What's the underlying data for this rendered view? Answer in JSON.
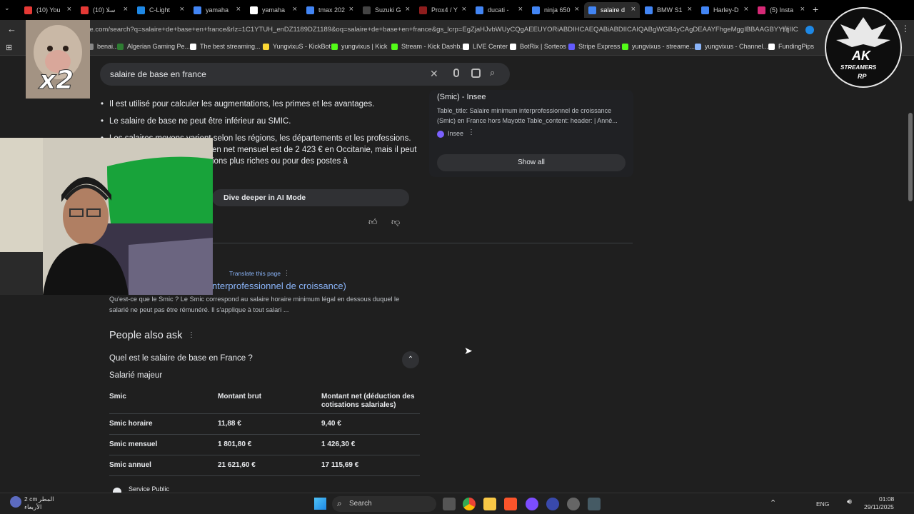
{
  "tabs": [
    {
      "label": "(10) You",
      "color": "#e53935",
      "active": false
    },
    {
      "label": "سلا (10)",
      "color": "#e53935",
      "active": false
    },
    {
      "label": "C-Light",
      "color": "#1e88e5",
      "active": false
    },
    {
      "label": "yamaha",
      "color": "#4285f4",
      "active": false
    },
    {
      "label": "yamaha",
      "color": "#ffffff",
      "active": false
    },
    {
      "label": "tmax 202",
      "color": "#4285f4",
      "active": false
    },
    {
      "label": "Suzuki G",
      "color": "#444444",
      "active": false
    },
    {
      "label": "Prox4 / Y",
      "color": "#8e1d1d",
      "active": false
    },
    {
      "label": "ducati -",
      "color": "#4285f4",
      "active": false
    },
    {
      "label": "ninja 650",
      "color": "#4285f4",
      "active": false
    },
    {
      "label": "salaire d",
      "color": "#4285f4",
      "active": true
    },
    {
      "label": "BMW S1",
      "color": "#4285f4",
      "active": false
    },
    {
      "label": "Harley-D",
      "color": "#4285f4",
      "active": false
    },
    {
      "label": "(5) Insta",
      "color": "#d62976",
      "active": false
    }
  ],
  "address": {
    "url": "gle.com/search?q=salaire+de+base+en+france&rlz=1C1YTUH_enDZ1189DZ1189&oq=salaire+de+base+en+france&gs_lcrp=EgZjaHJvbWUyCQgAEEUYORiABDIHCAEQABiABDIICAIQABgWGB4yCAgDEAAYFhgeMggIBBAAGBYYHjIICA..."
  },
  "bookmarks": [
    {
      "label": "benai...",
      "color": "#888888"
    },
    {
      "label": "Algerian Gaming Pe...",
      "color": "#2e7d32"
    },
    {
      "label": "The best streaming...",
      "color": "#ffffff"
    },
    {
      "label": "YungvixuS - KickBot",
      "color": "#fdd835"
    },
    {
      "label": "yungvixus | Kick",
      "color": "#53fc18"
    },
    {
      "label": "Stream - Kick Dashb...",
      "color": "#53fc18"
    },
    {
      "label": "LIVE Center",
      "color": "#ffffff"
    },
    {
      "label": "BotRix | Sorteos",
      "color": "#ffffff"
    },
    {
      "label": "Stripe Express",
      "color": "#635bff"
    },
    {
      "label": "yungvixus - streame...",
      "color": "#53fc18"
    },
    {
      "label": "yungvixus - Channel...",
      "color": "#8ab4f8"
    },
    {
      "label": "FundingPips",
      "color": "#ffffff"
    }
  ],
  "search": {
    "query": "salaire de base en france"
  },
  "ai_overview": {
    "bullet1": "Il est utilisé pour calculer les augmentations, les primes et les avantages.",
    "bullet2": "Le salaire de base ne peut être inférieur au SMIC.",
    "bullet3": "Les salaires moyens varient selon les régions, les départements et les professions.",
    "line3b": "en net mensuel est de 2 423 € en Occitanie, mais il peut",
    "line3c": "ions plus riches ou pour des postes à",
    "dive_label": "Dive deeper in AI Mode"
  },
  "right_card": {
    "title": "(Smic) - Insee",
    "snippet1": "Table_title: Salaire minimum interprofessionnel de croissance",
    "snippet2": "(Smic) en France hors Mayotte Table_content: header: | Anné...",
    "source": "Insee",
    "show_all": "Show all"
  },
  "result": {
    "translate": "Translate this page",
    "title": "nterprofessionnel de croissance)",
    "snippet1": "Qu'est-ce que le Smic ? Le Smic correspond au salaire horaire minimum légal en dessous duquel le",
    "snippet2": "salarié ne peut pas être rémunéré. Il s'applique à tout salari ..."
  },
  "paa": {
    "heading": "People also ask",
    "question": "Quel est le salaire de base en France ?",
    "subtitle": "Salarié majeur",
    "headers": [
      "Smic",
      "Montant brut",
      "Montant net (déduction des",
      "cotisations salariales)"
    ],
    "rows": [
      [
        "Smic horaire",
        "11,88 €",
        "9,40 €"
      ],
      [
        "Smic mensuel",
        "1 801,80 €",
        "1 426,30 €"
      ],
      [
        "Smic annuel",
        "21 621,60 €",
        "17 115,69 €"
      ]
    ],
    "source": "Service Public"
  },
  "overlay": {
    "x2": "x2",
    "logo_line1": "AK",
    "logo_line2": "STREAMERS",
    "logo_line3": "RP"
  },
  "taskbar": {
    "weather_temp": "2 cm",
    "weather_text1": "المطر",
    "weather_text2": "الأربعاء",
    "search": "Search",
    "lang": "ENG",
    "time": "01:08",
    "date": "29/11/2025"
  }
}
